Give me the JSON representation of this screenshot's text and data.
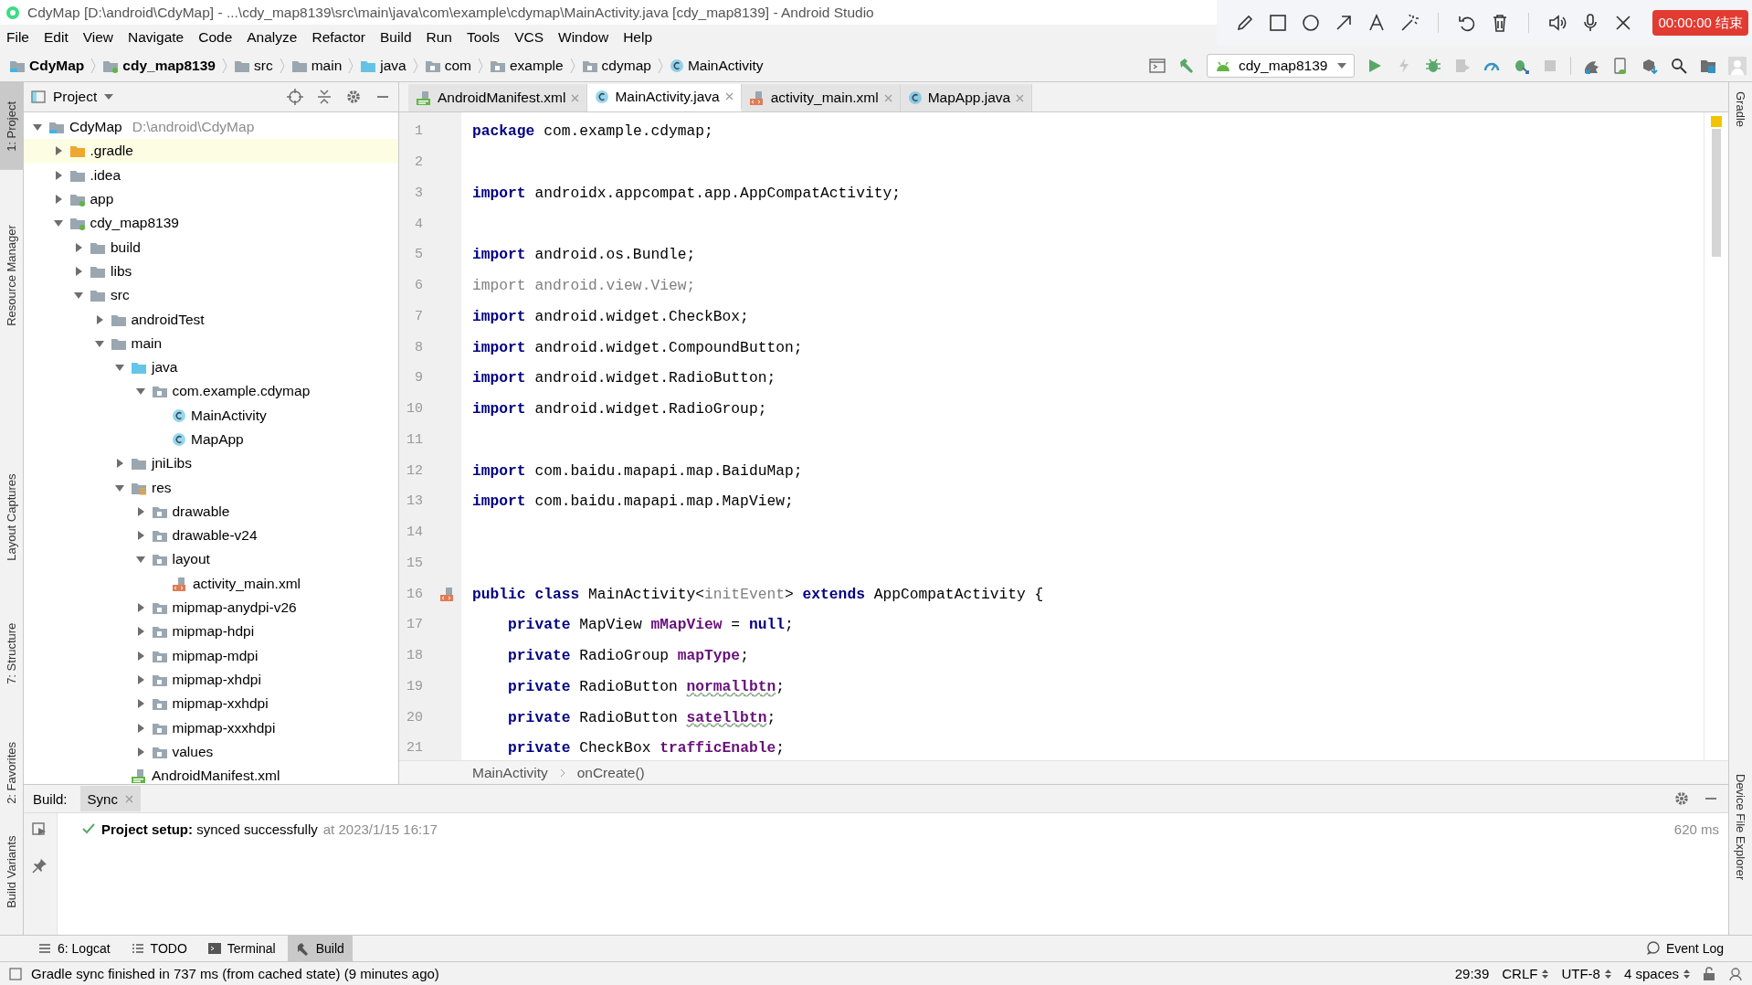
{
  "window": {
    "title": "CdyMap [D:\\android\\CdyMap] - ...\\cdy_map8139\\src\\main\\java\\com\\example\\cdymap\\MainActivity.java [cdy_map8139] - Android Studio"
  },
  "recorder": {
    "tools": [
      {
        "kind": "pencil"
      },
      {
        "kind": "square"
      },
      {
        "kind": "circle"
      },
      {
        "kind": "arrow"
      },
      {
        "kind": "text"
      },
      {
        "kind": "wand"
      },
      {
        "kind": "undo"
      },
      {
        "kind": "trash"
      },
      {
        "kind": "speaker"
      },
      {
        "kind": "mic"
      },
      {
        "kind": "close"
      }
    ],
    "timer": "00:00:00 结束"
  },
  "menu": [
    "File",
    "Edit",
    "View",
    "Navigate",
    "Code",
    "Analyze",
    "Refactor",
    "Build",
    "Run",
    "Tools",
    "VCS",
    "Window",
    "Help"
  ],
  "nav_bar": {
    "breadcrumbs": [
      {
        "label": "CdyMap",
        "kind": "project",
        "bold": true
      },
      {
        "label": "cdy_map8139",
        "kind": "module",
        "bold": true
      },
      {
        "label": "src",
        "kind": "folder",
        "bold": false
      },
      {
        "label": "main",
        "kind": "folder",
        "bold": false
      },
      {
        "label": "java",
        "kind": "source",
        "bold": false
      },
      {
        "label": "com",
        "kind": "package",
        "bold": false
      },
      {
        "label": "example",
        "kind": "package",
        "bold": false
      },
      {
        "label": "cdymap",
        "kind": "package",
        "bold": false
      },
      {
        "label": "MainActivity",
        "kind": "class",
        "bold": false
      }
    ],
    "run_config": "cdy_map8139"
  },
  "left_strip": [
    {
      "label": "1: Project",
      "selected": true
    },
    {
      "label": "Resource Manager",
      "selected": false
    },
    {
      "label": "Layout Captures",
      "selected": false
    },
    {
      "label": "7: Structure",
      "selected": false
    },
    {
      "label": "2: Favorites",
      "selected": false
    },
    {
      "label": "Build Variants",
      "selected": false
    }
  ],
  "right_strip": [
    {
      "label": "Gradle"
    },
    {
      "label": "Device File Explorer"
    }
  ],
  "project_panel": {
    "title": "Project",
    "tree": [
      {
        "label": "CdyMap",
        "path": "D:\\android\\CdyMap",
        "kind": "project",
        "expanded": true,
        "selected": false,
        "children": [
          {
            "label": ".gradle",
            "kind": "excluded",
            "expanded": false,
            "selected": true
          },
          {
            "label": ".idea",
            "kind": "folder",
            "expanded": false,
            "selected": false
          },
          {
            "label": "app",
            "kind": "module",
            "expanded": false,
            "selected": false
          },
          {
            "label": "cdy_map8139",
            "kind": "module",
            "expanded": true,
            "selected": false,
            "children": [
              {
                "label": "build",
                "kind": "folder",
                "expanded": false,
                "selected": false
              },
              {
                "label": "libs",
                "kind": "folder",
                "expanded": false,
                "selected": false
              },
              {
                "label": "src",
                "kind": "folder",
                "expanded": true,
                "selected": false,
                "children": [
                  {
                    "label": "androidTest",
                    "kind": "folder",
                    "expanded": false,
                    "selected": false
                  },
                  {
                    "label": "main",
                    "kind": "folder",
                    "expanded": true,
                    "selected": false,
                    "children": [
                      {
                        "label": "java",
                        "kind": "source",
                        "expanded": true,
                        "selected": false,
                        "children": [
                          {
                            "label": "com.example.cdymap",
                            "kind": "package",
                            "expanded": true,
                            "selected": false,
                            "children": [
                              {
                                "label": "MainActivity",
                                "kind": "class",
                                "selected": false
                              },
                              {
                                "label": "MapApp",
                                "kind": "class",
                                "selected": false
                              }
                            ]
                          }
                        ]
                      },
                      {
                        "label": "jniLibs",
                        "kind": "folder",
                        "expanded": false,
                        "selected": false
                      },
                      {
                        "label": "res",
                        "kind": "resources",
                        "expanded": true,
                        "selected": false,
                        "children": [
                          {
                            "label": "drawable",
                            "kind": "package",
                            "expanded": false,
                            "selected": false
                          },
                          {
                            "label": "drawable-v24",
                            "kind": "package",
                            "expanded": false,
                            "selected": false
                          },
                          {
                            "label": "layout",
                            "kind": "package",
                            "expanded": true,
                            "selected": false,
                            "children": [
                              {
                                "label": "activity_main.xml",
                                "kind": "layout",
                                "selected": false
                              }
                            ]
                          },
                          {
                            "label": "mipmap-anydpi-v26",
                            "kind": "package",
                            "expanded": false,
                            "selected": false
                          },
                          {
                            "label": "mipmap-hdpi",
                            "kind": "package",
                            "expanded": false,
                            "selected": false
                          },
                          {
                            "label": "mipmap-mdpi",
                            "kind": "package",
                            "expanded": false,
                            "selected": false
                          },
                          {
                            "label": "mipmap-xhdpi",
                            "kind": "package",
                            "expanded": false,
                            "selected": false
                          },
                          {
                            "label": "mipmap-xxhdpi",
                            "kind": "package",
                            "expanded": false,
                            "selected": false
                          },
                          {
                            "label": "mipmap-xxxhdpi",
                            "kind": "package",
                            "expanded": false,
                            "selected": false
                          },
                          {
                            "label": "values",
                            "kind": "package",
                            "expanded": false,
                            "selected": false
                          }
                        ]
                      },
                      {
                        "label": "AndroidManifest.xml",
                        "kind": "manifest",
                        "selected": false
                      }
                    ]
                  }
                ]
              }
            ]
          }
        ]
      }
    ]
  },
  "editor_tabs": [
    {
      "label": "AndroidManifest.xml",
      "kind": "manifest",
      "selected": false
    },
    {
      "label": "MainActivity.java",
      "kind": "class",
      "selected": true
    },
    {
      "label": "activity_main.xml",
      "kind": "layout",
      "selected": false
    },
    {
      "label": "MapApp.java",
      "kind": "class",
      "selected": false
    }
  ],
  "code": [
    {
      "number": "1",
      "kind": "plain",
      "tokens": [
        {
          "text": "package",
          "kind": "keyword"
        },
        {
          "text": " com.example.cdymap;",
          "kind": "plain"
        }
      ]
    },
    {
      "number": "2",
      "kind": "plain"
    },
    {
      "number": "3",
      "kind": "plain",
      "tokens": [
        {
          "text": "import",
          "kind": "keyword"
        },
        {
          "text": " androidx.appcompat.app.AppCompatActivity;",
          "kind": "plain"
        }
      ]
    },
    {
      "number": "4",
      "kind": "plain"
    },
    {
      "number": "5",
      "kind": "plain",
      "tokens": [
        {
          "text": "import",
          "kind": "keyword"
        },
        {
          "text": " android.os.Bundle;",
          "kind": "plain"
        }
      ]
    },
    {
      "number": "6",
      "kind": "plain",
      "tokens": [
        {
          "text": "import android.view.View;",
          "kind": "unused"
        }
      ]
    },
    {
      "number": "7",
      "kind": "plain",
      "tokens": [
        {
          "text": "import",
          "kind": "keyword"
        },
        {
          "text": " android.widget.CheckBox;",
          "kind": "plain"
        }
      ]
    },
    {
      "number": "8",
      "kind": "plain",
      "tokens": [
        {
          "text": "import",
          "kind": "keyword"
        },
        {
          "text": " android.widget.CompoundButton;",
          "kind": "plain"
        }
      ]
    },
    {
      "number": "9",
      "kind": "plain",
      "tokens": [
        {
          "text": "import",
          "kind": "keyword"
        },
        {
          "text": " android.widget.RadioButton;",
          "kind": "plain"
        }
      ]
    },
    {
      "number": "10",
      "kind": "plain",
      "tokens": [
        {
          "text": "import",
          "kind": "keyword"
        },
        {
          "text": " android.widget.RadioGroup;",
          "kind": "plain"
        }
      ]
    },
    {
      "number": "11",
      "kind": "plain"
    },
    {
      "number": "12",
      "kind": "plain",
      "tokens": [
        {
          "text": "import",
          "kind": "keyword"
        },
        {
          "text": " com.baidu.mapapi.map.BaiduMap;",
          "kind": "plain"
        }
      ]
    },
    {
      "number": "13",
      "kind": "plain",
      "tokens": [
        {
          "text": "import",
          "kind": "keyword"
        },
        {
          "text": " com.baidu.mapapi.map.MapView;",
          "kind": "plain"
        }
      ]
    },
    {
      "number": "14",
      "kind": "plain"
    },
    {
      "number": "15",
      "kind": "plain"
    },
    {
      "number": "16",
      "kind": "layout-link",
      "tokens": [
        {
          "text": "public class",
          "kind": "keyword"
        },
        {
          "text": " MainActivity<",
          "kind": "plain"
        },
        {
          "text": "initEvent",
          "kind": "unused"
        },
        {
          "text": "> ",
          "kind": "plain"
        },
        {
          "text": "extends",
          "kind": "keyword"
        },
        {
          "text": " AppCompatActivity {",
          "kind": "plain"
        }
      ]
    },
    {
      "number": "17",
      "kind": "plain",
      "tokens": [
        {
          "text": "    private",
          "kind": "keyword"
        },
        {
          "text": " MapView ",
          "kind": "plain"
        },
        {
          "text": "mMapView",
          "kind": "field"
        },
        {
          "text": " = ",
          "kind": "plain"
        },
        {
          "text": "null",
          "kind": "keyword"
        },
        {
          "text": ";",
          "kind": "plain"
        }
      ]
    },
    {
      "number": "18",
      "kind": "plain",
      "tokens": [
        {
          "text": "    private",
          "kind": "keyword"
        },
        {
          "text": " RadioGroup ",
          "kind": "plain"
        },
        {
          "text": "mapType",
          "kind": "field"
        },
        {
          "text": ";",
          "kind": "plain"
        }
      ]
    },
    {
      "number": "19",
      "kind": "plain",
      "tokens": [
        {
          "text": "    private",
          "kind": "keyword"
        },
        {
          "text": " RadioButton ",
          "kind": "plain"
        },
        {
          "text": "normallbtn",
          "kind": "typo"
        },
        {
          "text": ";",
          "kind": "plain"
        }
      ]
    },
    {
      "number": "20",
      "kind": "plain",
      "tokens": [
        {
          "text": "    private",
          "kind": "keyword"
        },
        {
          "text": " RadioButton ",
          "kind": "plain"
        },
        {
          "text": "satellbtn",
          "kind": "typo"
        },
        {
          "text": ";",
          "kind": "plain"
        }
      ]
    },
    {
      "number": "21",
      "kind": "plain",
      "tokens": [
        {
          "text": "    private",
          "kind": "keyword"
        },
        {
          "text": " CheckBox ",
          "kind": "plain"
        },
        {
          "text": "trafficEnable",
          "kind": "field"
        },
        {
          "text": ";",
          "kind": "plain"
        }
      ]
    }
  ],
  "editor_breadcrumbs": [
    "MainActivity",
    "onCreate()"
  ],
  "build_panel": {
    "label": "Build:",
    "tabs": [
      {
        "label": "Sync",
        "selected": true
      }
    ],
    "message": "**Project setup:** synced successfully",
    "timestamp": "at 2023/1/15 16:17",
    "duration": "620 ms"
  },
  "bottom_tabs": [
    {
      "label": "6: Logcat",
      "selected": false
    },
    {
      "label": "TODO",
      "selected": false
    },
    {
      "label": "Terminal",
      "selected": false
    },
    {
      "label": "Build",
      "selected": true
    }
  ],
  "event_log": "Event Log",
  "status_bar": {
    "message": "Gradle sync finished in 737 ms (from cached state) (9 minutes ago)",
    "position": "29:39",
    "line_separator": "CRLF",
    "encoding": "UTF-8",
    "indent": "4 spaces"
  }
}
